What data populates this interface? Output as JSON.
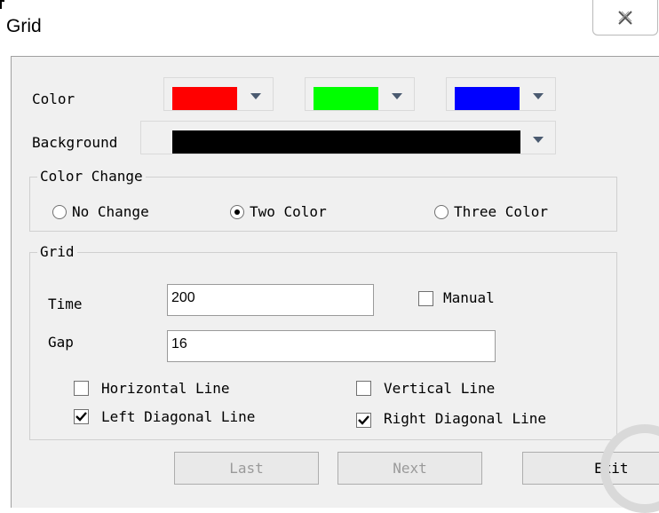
{
  "window": {
    "title": "Grid"
  },
  "color_row": {
    "label": "Color",
    "colors": [
      "#ff0000",
      "#00ff00",
      "#0000ff"
    ]
  },
  "background_row": {
    "label": "Background",
    "color": "#000000"
  },
  "color_change": {
    "title": "Color Change",
    "options": [
      "No Change",
      "Two Color",
      "Three Color"
    ],
    "selected": "Two Color"
  },
  "grid": {
    "title": "Grid",
    "time_label": "Time",
    "time_value": "200",
    "manual_label": "Manual",
    "manual_checked": false,
    "gap_label": "Gap",
    "gap_value": "16",
    "lines": [
      {
        "label": "Horizontal Line",
        "checked": false
      },
      {
        "label": "Vertical Line",
        "checked": false
      },
      {
        "label": "Left Diagonal Line",
        "checked": true
      },
      {
        "label": "Right Diagonal Line",
        "checked": true
      }
    ]
  },
  "buttons": {
    "last": "Last",
    "next": "Next",
    "exit": "Exit"
  }
}
